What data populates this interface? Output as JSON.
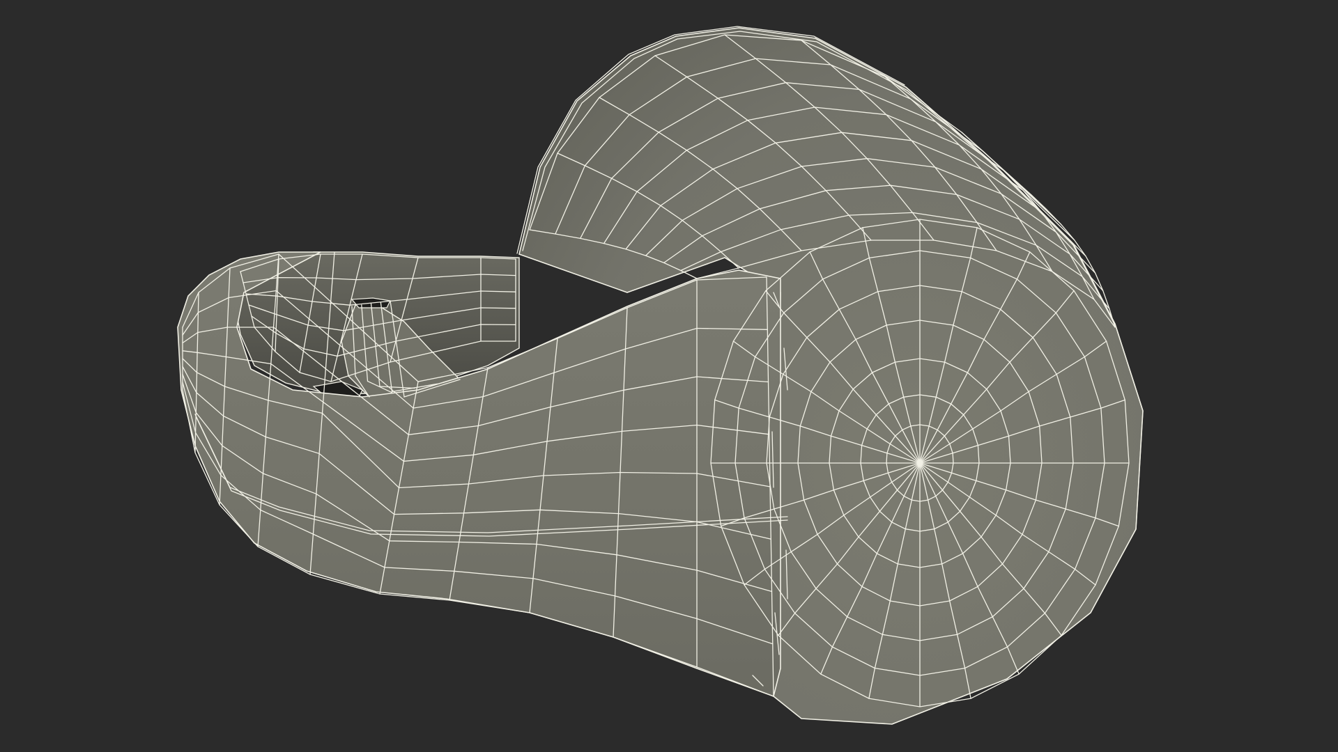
{
  "viewport": {
    "background_color": "#2b2b2b"
  },
  "model": {
    "subject": "wireframe-3d-mesh",
    "surface_color": "#77776c",
    "surface_dark_color": "#5e5e55",
    "interior_color": "#4a4a44",
    "hole_color": "#1e1e1c",
    "wire_color": "#f2f1e6"
  }
}
